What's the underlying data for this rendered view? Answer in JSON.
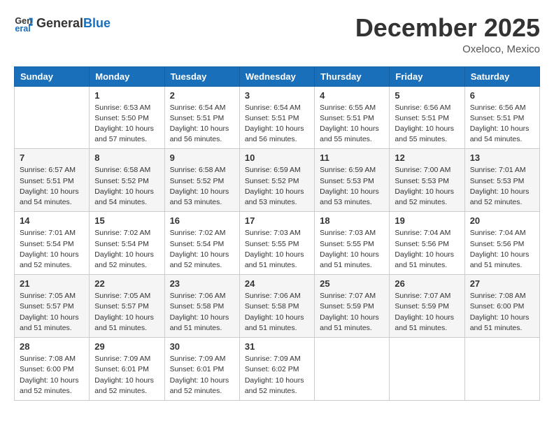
{
  "header": {
    "logo_general": "General",
    "logo_blue": "Blue",
    "month": "December 2025",
    "location": "Oxeloco, Mexico"
  },
  "weekdays": [
    "Sunday",
    "Monday",
    "Tuesday",
    "Wednesday",
    "Thursday",
    "Friday",
    "Saturday"
  ],
  "weeks": [
    [
      {
        "day": "",
        "info": ""
      },
      {
        "day": "1",
        "info": "Sunrise: 6:53 AM\nSunset: 5:50 PM\nDaylight: 10 hours\nand 57 minutes."
      },
      {
        "day": "2",
        "info": "Sunrise: 6:54 AM\nSunset: 5:51 PM\nDaylight: 10 hours\nand 56 minutes."
      },
      {
        "day": "3",
        "info": "Sunrise: 6:54 AM\nSunset: 5:51 PM\nDaylight: 10 hours\nand 56 minutes."
      },
      {
        "day": "4",
        "info": "Sunrise: 6:55 AM\nSunset: 5:51 PM\nDaylight: 10 hours\nand 55 minutes."
      },
      {
        "day": "5",
        "info": "Sunrise: 6:56 AM\nSunset: 5:51 PM\nDaylight: 10 hours\nand 55 minutes."
      },
      {
        "day": "6",
        "info": "Sunrise: 6:56 AM\nSunset: 5:51 PM\nDaylight: 10 hours\nand 54 minutes."
      }
    ],
    [
      {
        "day": "7",
        "info": "Sunrise: 6:57 AM\nSunset: 5:51 PM\nDaylight: 10 hours\nand 54 minutes."
      },
      {
        "day": "8",
        "info": "Sunrise: 6:58 AM\nSunset: 5:52 PM\nDaylight: 10 hours\nand 54 minutes."
      },
      {
        "day": "9",
        "info": "Sunrise: 6:58 AM\nSunset: 5:52 PM\nDaylight: 10 hours\nand 53 minutes."
      },
      {
        "day": "10",
        "info": "Sunrise: 6:59 AM\nSunset: 5:52 PM\nDaylight: 10 hours\nand 53 minutes."
      },
      {
        "day": "11",
        "info": "Sunrise: 6:59 AM\nSunset: 5:53 PM\nDaylight: 10 hours\nand 53 minutes."
      },
      {
        "day": "12",
        "info": "Sunrise: 7:00 AM\nSunset: 5:53 PM\nDaylight: 10 hours\nand 52 minutes."
      },
      {
        "day": "13",
        "info": "Sunrise: 7:01 AM\nSunset: 5:53 PM\nDaylight: 10 hours\nand 52 minutes."
      }
    ],
    [
      {
        "day": "14",
        "info": "Sunrise: 7:01 AM\nSunset: 5:54 PM\nDaylight: 10 hours\nand 52 minutes."
      },
      {
        "day": "15",
        "info": "Sunrise: 7:02 AM\nSunset: 5:54 PM\nDaylight: 10 hours\nand 52 minutes."
      },
      {
        "day": "16",
        "info": "Sunrise: 7:02 AM\nSunset: 5:54 PM\nDaylight: 10 hours\nand 52 minutes."
      },
      {
        "day": "17",
        "info": "Sunrise: 7:03 AM\nSunset: 5:55 PM\nDaylight: 10 hours\nand 51 minutes."
      },
      {
        "day": "18",
        "info": "Sunrise: 7:03 AM\nSunset: 5:55 PM\nDaylight: 10 hours\nand 51 minutes."
      },
      {
        "day": "19",
        "info": "Sunrise: 7:04 AM\nSunset: 5:56 PM\nDaylight: 10 hours\nand 51 minutes."
      },
      {
        "day": "20",
        "info": "Sunrise: 7:04 AM\nSunset: 5:56 PM\nDaylight: 10 hours\nand 51 minutes."
      }
    ],
    [
      {
        "day": "21",
        "info": "Sunrise: 7:05 AM\nSunset: 5:57 PM\nDaylight: 10 hours\nand 51 minutes."
      },
      {
        "day": "22",
        "info": "Sunrise: 7:05 AM\nSunset: 5:57 PM\nDaylight: 10 hours\nand 51 minutes."
      },
      {
        "day": "23",
        "info": "Sunrise: 7:06 AM\nSunset: 5:58 PM\nDaylight: 10 hours\nand 51 minutes."
      },
      {
        "day": "24",
        "info": "Sunrise: 7:06 AM\nSunset: 5:58 PM\nDaylight: 10 hours\nand 51 minutes."
      },
      {
        "day": "25",
        "info": "Sunrise: 7:07 AM\nSunset: 5:59 PM\nDaylight: 10 hours\nand 51 minutes."
      },
      {
        "day": "26",
        "info": "Sunrise: 7:07 AM\nSunset: 5:59 PM\nDaylight: 10 hours\nand 51 minutes."
      },
      {
        "day": "27",
        "info": "Sunrise: 7:08 AM\nSunset: 6:00 PM\nDaylight: 10 hours\nand 51 minutes."
      }
    ],
    [
      {
        "day": "28",
        "info": "Sunrise: 7:08 AM\nSunset: 6:00 PM\nDaylight: 10 hours\nand 52 minutes."
      },
      {
        "day": "29",
        "info": "Sunrise: 7:09 AM\nSunset: 6:01 PM\nDaylight: 10 hours\nand 52 minutes."
      },
      {
        "day": "30",
        "info": "Sunrise: 7:09 AM\nSunset: 6:01 PM\nDaylight: 10 hours\nand 52 minutes."
      },
      {
        "day": "31",
        "info": "Sunrise: 7:09 AM\nSunset: 6:02 PM\nDaylight: 10 hours\nand 52 minutes."
      },
      {
        "day": "",
        "info": ""
      },
      {
        "day": "",
        "info": ""
      },
      {
        "day": "",
        "info": ""
      }
    ]
  ]
}
